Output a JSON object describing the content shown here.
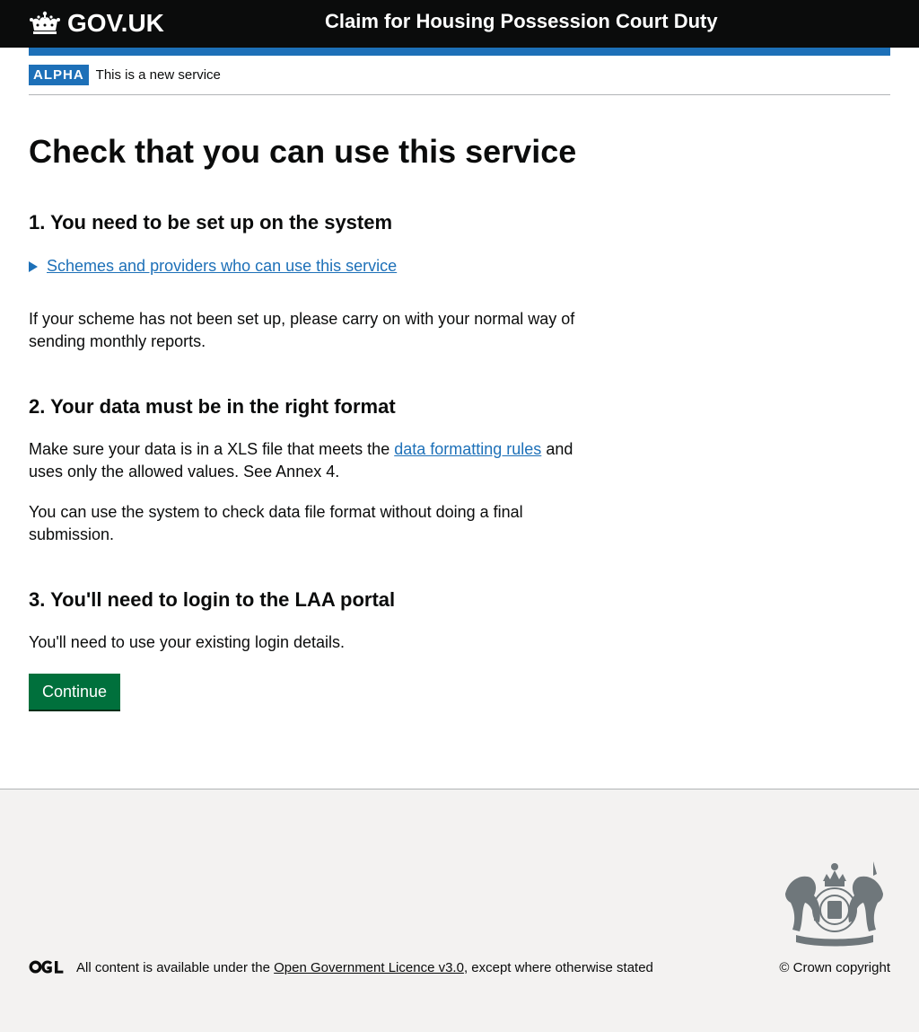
{
  "header": {
    "logo_text": "GOV.UK",
    "logo_icon": "crown-icon",
    "service_name": "Claim for Housing Possession Court Duty"
  },
  "phase_banner": {
    "tag": "ALPHA",
    "text": "This is a new service"
  },
  "main": {
    "title": "Check that you can use this service",
    "section1": {
      "heading": "1. You need to be set up on the system",
      "details_summary": "Schemes and providers who can use this service",
      "paragraph": "If your scheme has not been set up, please carry on with your normal way of sending monthly reports."
    },
    "section2": {
      "heading": "2. Your data must be in the right format",
      "paragraph1_before": "Make sure your data is in a XLS file that meets the ",
      "paragraph1_link": "data formatting rules",
      "paragraph1_after": " and uses only the allowed values. See Annex 4.",
      "paragraph2": "You can use the system to check data file format without doing a final submission."
    },
    "section3": {
      "heading": "3. You'll need to login to the LAA portal",
      "paragraph": "You'll need to use your existing login details."
    },
    "continue_label": "Continue"
  },
  "footer": {
    "licence_before": "All content is available under the ",
    "licence_link": "Open Government Licence v3.0",
    "licence_after": ", except where otherwise stated",
    "copyright": "© Crown copyright",
    "ogl_icon": "ogl-logo-icon",
    "crest_icon": "royal-coat-of-arms-icon"
  },
  "colors": {
    "header_bg": "#0b0c0c",
    "brand_blue": "#1d70b8",
    "button_green": "#00703c",
    "footer_bg": "#f3f2f1"
  }
}
